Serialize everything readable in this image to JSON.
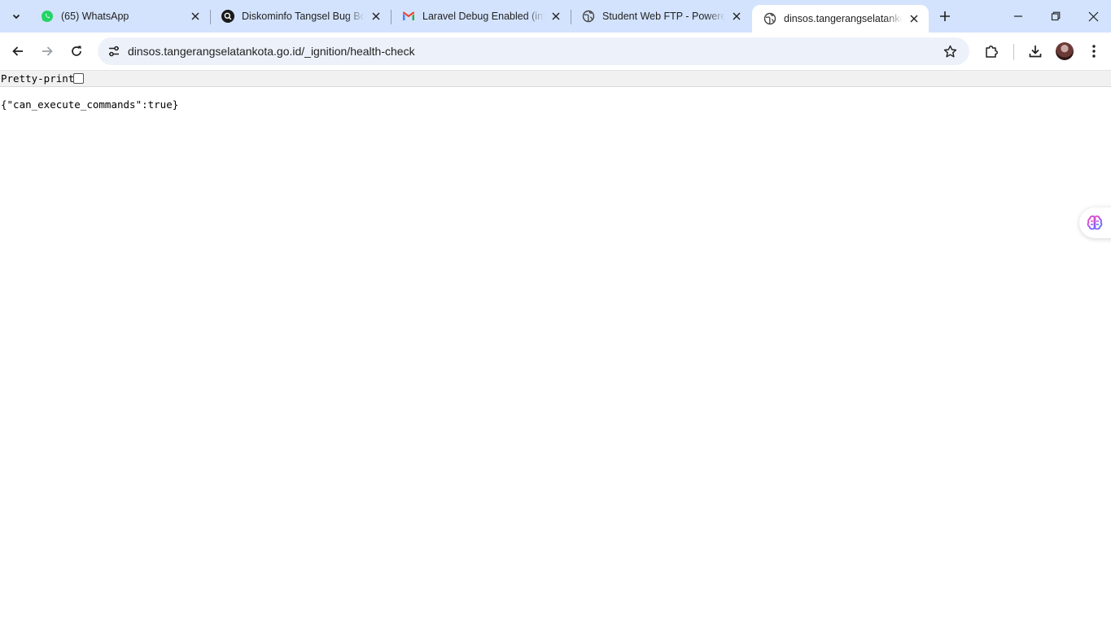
{
  "browser": {
    "tabs": [
      {
        "title": "(65) WhatsApp",
        "icon": "whatsapp-icon",
        "active": false
      },
      {
        "title": "Diskominfo Tangsel Bug Bou",
        "icon": "search-site-icon",
        "active": false
      },
      {
        "title": "Laravel Debug Enabled (info",
        "icon": "gmail-icon",
        "active": false
      },
      {
        "title": "Student Web FTP - Powered",
        "icon": "globe-icon",
        "active": false
      },
      {
        "title": "dinsos.tangerangselatankota",
        "icon": "globe-icon",
        "active": true
      }
    ],
    "address": "dinsos.tangerangselatankota.go.id/_ignition/health-check",
    "colors": {
      "tabstrip": "#d3e3fd",
      "omnibox": "#edf2fa",
      "whatsapp": "#25d366"
    }
  },
  "viewer": {
    "pretty_print_label": "Pretty-print",
    "pretty_print_checked": false
  },
  "content": {
    "json_text": "{\"can_execute_commands\":true}"
  }
}
